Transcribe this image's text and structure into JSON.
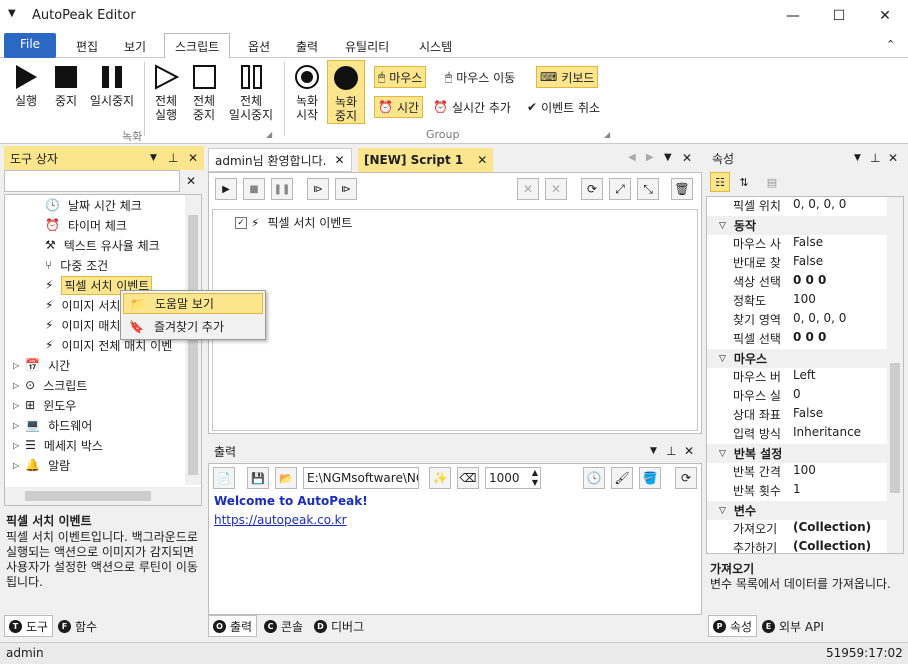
{
  "app": {
    "title": "AutoPeak Editor"
  },
  "tabs": [
    "File",
    "편집",
    "보기",
    "스크립트",
    "옵션",
    "출력",
    "유틸리티",
    "시스템"
  ],
  "ribbon": {
    "play": "실행",
    "stop": "중지",
    "pause": "일시중지",
    "all_run": "전체\n실행",
    "all_stop": "전체\n중지",
    "all_pause": "전체\n일시중지",
    "rec_start": "녹화\n시작",
    "rec_stop": "녹화\n중지",
    "group_rec": "녹화",
    "group_group": "Group",
    "mouse": "마우스",
    "mouse_move": "마우스 이동",
    "keyboard": "키보드",
    "time": "시간",
    "realtime_add": "실시간 추가",
    "event_cancel": "이벤트 취소"
  },
  "toolbox": {
    "title": "도구 상자",
    "items": [
      "날짜 시간 체크",
      "타이머 체크",
      "텍스트 유사율 체크",
      "다중 조건",
      "픽셀 서치 이벤트",
      "이미지 서치",
      "이미지 매치",
      "이미지 전체 매치 이벤"
    ],
    "categories": [
      "시간",
      "스크립트",
      "윈도우",
      "하드웨어",
      "메세지 박스",
      "알람"
    ],
    "desc_title": "픽셀 서치 이벤트",
    "desc": "픽셀 서치 이벤트입니다. 백그라운드로 실행되는 액션으로 이미지가 감지되면 사용자가 설정한 액션으로 루틴이 이동됩니다.",
    "tab_tools": "도구",
    "tab_funcs": "함수"
  },
  "context_menu": {
    "help": "도움말 보기",
    "favorite": "즐겨찾기 추가"
  },
  "doc": {
    "tab1": "admin님 환영합니다.",
    "tab2": "[NEW] Script 1",
    "script_item": "픽셀 서치 이벤트"
  },
  "output": {
    "title": "출력",
    "path": "E:\\NGMsoftware\\NG",
    "count": "1000",
    "welcome": "Welcome to AutoPeak!",
    "link": "https://autopeak.co.kr",
    "tab_output": "출력",
    "tab_console": "콘솔",
    "tab_debug": "디버그"
  },
  "props": {
    "title": "속성",
    "top_row": {
      "k": "픽셀 위치",
      "v": "0, 0, 0, 0"
    },
    "groups": [
      {
        "name": "동작",
        "rows": [
          {
            "k": "마우스 사",
            "v": "False"
          },
          {
            "k": "반대로 찾",
            "v": "False"
          },
          {
            "k": "색상 선택",
            "v": "0 0 0"
          },
          {
            "k": "정확도",
            "v": "100"
          },
          {
            "k": "찾기 영역",
            "v": "0, 0, 0, 0"
          },
          {
            "k": "픽셀 선택",
            "v": "0 0 0"
          }
        ]
      },
      {
        "name": "마우스",
        "rows": [
          {
            "k": "마우스 버",
            "v": "Left"
          },
          {
            "k": "마우스 실",
            "v": "0"
          },
          {
            "k": "상대 좌표",
            "v": "False"
          },
          {
            "k": "입력 방식",
            "v": "Inheritance"
          }
        ]
      },
      {
        "name": "반복 설정",
        "rows": [
          {
            "k": "반복 간격",
            "v": "100"
          },
          {
            "k": "반복 횟수",
            "v": "1"
          }
        ]
      },
      {
        "name": "변수",
        "rows": [
          {
            "k": "가져오기",
            "v": "(Collection)"
          },
          {
            "k": "추가하기",
            "v": "(Collection)"
          }
        ]
      }
    ],
    "desc_title": "가져오기",
    "desc": "변수 목록에서 데이터를 가져옵니다.",
    "tab_props": "속성",
    "tab_api": "외부 API"
  },
  "status": {
    "user": "admin",
    "time": "51959:17:02"
  }
}
